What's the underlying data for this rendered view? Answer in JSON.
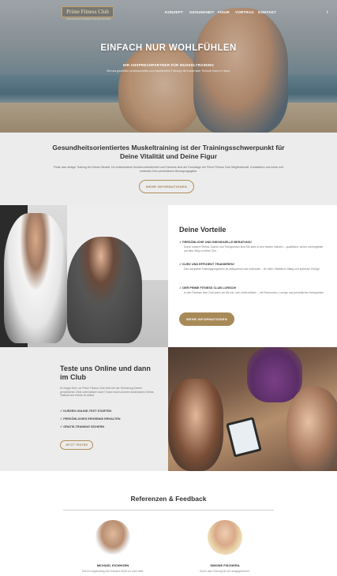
{
  "header": {
    "logo_text": "Prime Fitness Club",
    "logo_subtitle": "GESUNDHEITSORIENTIERTES MUSKELTRAINING",
    "nav": [
      "KONZEPT",
      "GESUNDHEIT",
      "FIGUR",
      "VORTRAG",
      "KONTAKT"
    ],
    "social_icon": "f"
  },
  "hero": {
    "title": "EINFACH NUR WOHLFÜHLEN",
    "subtitle": "IHR ANSPRECHPARTNER FÜR MUSKELTRAINING",
    "text": "Bei uns genießen professionelles und individuelles Training mit modernster Technik Hand in Hand."
  },
  "intro": {
    "title": "Gesundheitsorientiertes Muskeltraining ist der Trainingsschwerpunkt für Deine Vitalität und Deine Figur",
    "text": "Finde das richtige Training für Deinen Bedarf. Du entscheidest! Kundenzufriedenheit und Fairness sind die Grundlage der Prime Fitness Club Mitgliedschaft. Kontaktiere uns heute und entdecke Dein persönliches Bewegungsglück.",
    "button": "MEHR INFORMATIONEN"
  },
  "vorteile": {
    "title": "Deine Vorteile",
    "items": [
      {
        "head": "✓ PERSÖNLICHE UND INDIVIDUELLE BERATUNG!",
        "text": "Durch unsere Fitness-Trainer und Therapeuten sind Sie stets in den besten Händen – qualifiziert, sicher und begleitet auf dem Weg zu Ihrem Ziel."
      },
      {
        "head": "✓ KURZ UND EFFIZIENT TRAINIEREN!",
        "text": "Das kompakte Trainingsprogramm ist zeitsparend und individuell – für mehr Vitalität im Alltag und spürbare Erfolge."
      },
      {
        "head": "✓ DER PRIME FITNESS CLUB LORSCH!",
        "text": "In den Räumen des Club laden wir Sie ein, sich wohlzufühlen – mit Ruhezonen, Lounge und persönlicher Atmosphäre."
      }
    ],
    "button": "MEHR INFORMATIONEN"
  },
  "online": {
    "title": "Teste uns Online und dann im Club",
    "text": "Du fragst Dich, ob Prime Fitness Club Dich bei der Erreichung Deiner persönlichen Ziele unterstützen kann? Dann mach unseren kostenlosen Online-Testlauf und erlebe es selbst.",
    "list": [
      "✓ KURZEN ONLINE-TEST STARTEN",
      "✓ PERSÖNLICHES ERGEBNIS ERHALTEN",
      "✓ GRATIS-TRAINING SICHERN"
    ],
    "button": "JETZT TESTEN"
  },
  "references": {
    "title": "Referenzen & Feedback",
    "people": [
      {
        "name": "MICHAEL EICHHORN",
        "text": "Seit ich regelmäßig hier trainiere fühle ich mich fitter."
      },
      {
        "name": "SIMONE FISCHERA",
        "text": "Durch das Training bin ich ausgeglichener."
      }
    ]
  }
}
